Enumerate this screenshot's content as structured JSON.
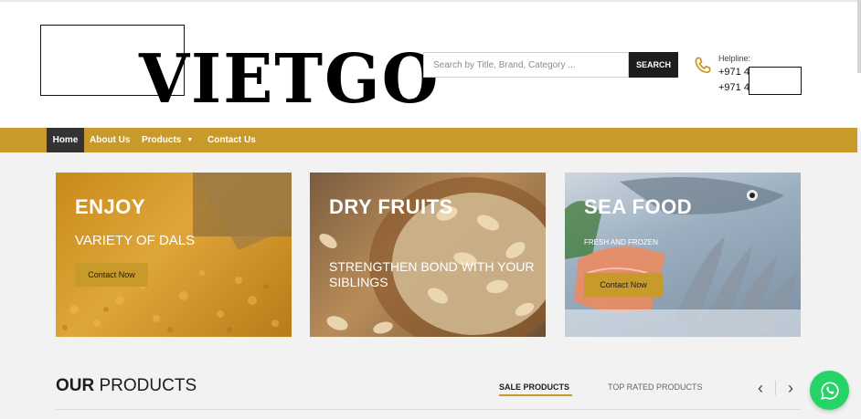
{
  "header": {
    "logo_text": "VIETGO",
    "search": {
      "placeholder": "Search by Title, Brand, Category ...",
      "button_label": "SEARCH"
    },
    "helpline": {
      "label": "Helpline:",
      "phone_1": "+971 4",
      "phone_2": "+971 4"
    }
  },
  "nav": {
    "items": [
      {
        "label": "Home",
        "active": true
      },
      {
        "label": "About Us"
      },
      {
        "label": "Products",
        "has_dropdown": true,
        "caret": "▼"
      },
      {
        "label": "Contact Us"
      }
    ]
  },
  "banners": [
    {
      "title": "ENJOY",
      "subtitle": "VARIETY OF DALS",
      "cta": "Contact Now"
    },
    {
      "title": "DRY FRUITS",
      "subtitle": "STRENGTHEN BOND WITH YOUR SIBLINGS"
    },
    {
      "title": "SEA FOOD",
      "subtitle": "FRESH AND FROZEN",
      "cta": "Contact Now"
    }
  ],
  "products_section": {
    "title_bold": "OUR",
    "title_rest": " PRODUCTS",
    "tabs": [
      {
        "label": "SALE PRODUCTS",
        "active": true
      },
      {
        "label": "TOP RATED PRODUCTS"
      }
    ],
    "prev_arrow": "‹",
    "next_arrow": "›"
  },
  "icons": {
    "phone": "phone-icon",
    "whatsapp": "whatsapp-icon",
    "dropdown": "caret-down-icon"
  },
  "colors": {
    "accent": "#c89a2c",
    "nav_active_bg": "#333333",
    "search_button": "#1d1d1d",
    "whatsapp": "#25d366",
    "page_bg": "#f2f2f2"
  }
}
